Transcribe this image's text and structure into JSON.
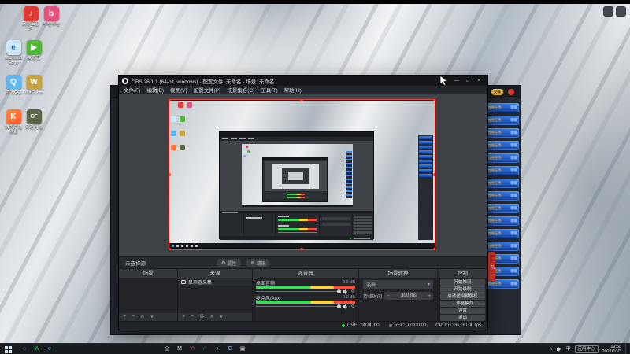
{
  "colors": {
    "accent_blue": "#2e7bf0",
    "banner_text_yellow": "#ffd84d",
    "meter_green": "#3ddc5a",
    "meter_yellow": "#ffd23c",
    "meter_red": "#ff4d3c",
    "live_dot_green": "#2ecc40",
    "selection_red": "#ff3b30"
  },
  "desktop": {
    "icons": [
      {
        "label": "网易云音乐",
        "glyph": "♪"
      },
      {
        "label": "哔哩哔哩",
        "glyph": "b"
      },
      {
        "label": "Microsoft Edge",
        "glyph": "e"
      },
      {
        "label": "爱奇艺",
        "glyph": "▶"
      },
      {
        "label": "腾讯QQ",
        "glyph": "Q"
      },
      {
        "label": "WeGame",
        "glyph": "W"
      },
      {
        "label": "快手直播伴侣",
        "glyph": "K"
      },
      {
        "label": "穿越火线",
        "glyph": "CF"
      }
    ]
  },
  "live_window": {
    "recharge": "充值",
    "banner_left": "直播任务",
    "banner_right": "领取",
    "ribbon": "热"
  },
  "icons": {
    "gear": "⚙",
    "monitor": "▭",
    "chevron_up": "∧",
    "ime": "中"
  },
  "obs": {
    "title": "OBS 26.1.1 (64-bit, windows) - 配置文件: 未命名 - 场景: 未命名",
    "min": "—",
    "max": "□",
    "close": "×",
    "menu": [
      "文件(F)",
      "编辑(E)",
      "视图(V)",
      "配置文件(P)",
      "场景集合(C)",
      "工具(T)",
      "帮助(H)"
    ],
    "context_bar": {
      "no_source": "未选择源",
      "properties": "属性",
      "filters": "滤镜"
    },
    "scenes": {
      "title": "场景",
      "add": "+",
      "remove": "−",
      "up": "∧",
      "down": "∨"
    },
    "sources": {
      "title": "来源",
      "item": "显示器采集",
      "add": "+",
      "remove": "−",
      "up": "∧",
      "down": "∨"
    },
    "mixer": {
      "title": "混音器",
      "ch1": {
        "name": "桌面音频",
        "db": "0.0 dB"
      },
      "ch2": {
        "name": "麦克风/Aux",
        "db": "0.0 dB"
      }
    },
    "transitions": {
      "title": "场景转换",
      "value": "淡出",
      "caret": "▾",
      "duration_label": "持续时间",
      "minus": "−",
      "plus": "+",
      "duration": "300 ms"
    },
    "controls": {
      "title": "控制",
      "buttons": [
        "开始推流",
        "开始录制",
        "启动虚拟摄像机",
        "工作室模式",
        "设置",
        "退出"
      ]
    },
    "status": {
      "live_label": "LIVE:",
      "live_time": "00:00:00",
      "rec_label": "REC:",
      "rec_time": "00:00:00",
      "cpu": "CPU: 0.3%, 30.00 fps"
    }
  },
  "taskbar": {
    "left_icons": [
      {
        "name": "search",
        "glyph": "◌"
      },
      {
        "name": "wechat",
        "glyph": "W"
      },
      {
        "name": "edge",
        "glyph": "e"
      }
    ],
    "center_icons": [
      {
        "name": "obs",
        "glyph": "◎"
      },
      {
        "name": "mic",
        "glyph": "M"
      },
      {
        "name": "yy",
        "glyph": "Y!"
      },
      {
        "name": "headset",
        "glyph": "∩"
      },
      {
        "name": "music",
        "glyph": "♪"
      },
      {
        "name": "chat",
        "glyph": "C"
      },
      {
        "name": "store",
        "glyph": "▣"
      }
    ],
    "tray": {
      "app_center": "应用中心",
      "time": "19:50",
      "date": "2021/10/3"
    }
  }
}
